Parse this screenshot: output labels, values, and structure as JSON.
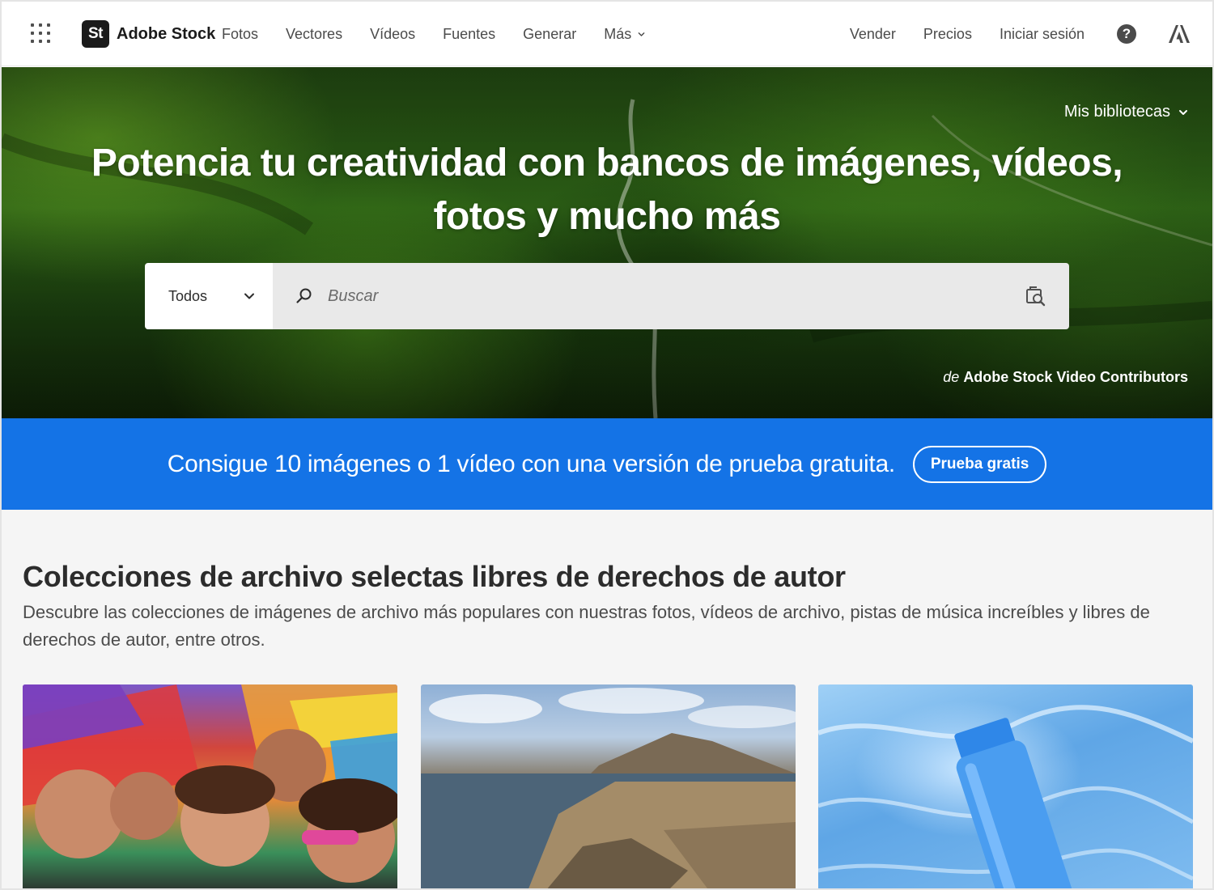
{
  "header": {
    "logo_badge": "St",
    "logo_text": "Adobe Stock",
    "nav": [
      "Fotos",
      "Vectores",
      "Vídeos",
      "Fuentes",
      "Generar"
    ],
    "more_label": "Más",
    "right_nav": [
      "Vender",
      "Precios",
      "Iniciar sesión"
    ],
    "help_label": "?"
  },
  "hero": {
    "libraries_label": "Mis bibliotecas",
    "title": "Potencia tu creatividad con bancos de imágenes, vídeos, fotos y mucho más",
    "search": {
      "type_label": "Todos",
      "placeholder": "Buscar"
    },
    "credit_prefix": "de",
    "credit_name": "Adobe Stock Video Contributors"
  },
  "banner": {
    "text": "Consigue 10 imágenes o 1 vídeo con una versión de prueba gratuita.",
    "button_label": "Prueba gratis",
    "color": "#1473e6"
  },
  "collections": {
    "title": "Colecciones de archivo selectas libres de derechos de autor",
    "description": "Descubre las colecciones de imágenes de archivo más populares con nuestras fotos, vídeos de archivo, pistas de música increíbles y libres de derechos de autor, entre otros.",
    "cards": [
      {
        "name": "pride-group-photo"
      },
      {
        "name": "coastal-landscape-photo"
      },
      {
        "name": "water-bottle-mockup-photo"
      }
    ]
  },
  "icons": {
    "app_switcher": "grid-icon",
    "chevron": "chevron-down-icon",
    "help": "help-icon",
    "adobe": "adobe-logo-icon",
    "search": "search-icon",
    "visual_search": "visual-search-icon"
  }
}
